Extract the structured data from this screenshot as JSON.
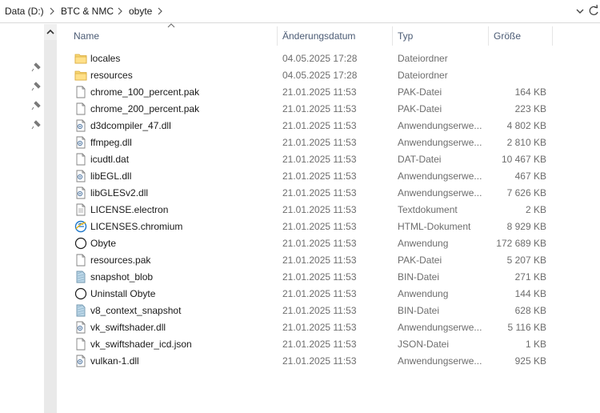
{
  "breadcrumb": {
    "parts": [
      "Data (D:)",
      "BTC & NMC",
      "obyte"
    ]
  },
  "columns": {
    "name": "Name",
    "date": "Änderungsdatum",
    "type": "Typ",
    "size": "Größe"
  },
  "files": [
    {
      "name": "locales",
      "date": "04.05.2025 17:28",
      "type": "Dateiordner",
      "size": "",
      "icon": "folder-icon"
    },
    {
      "name": "resources",
      "date": "04.05.2025 17:28",
      "type": "Dateiordner",
      "size": "",
      "icon": "folder-icon"
    },
    {
      "name": "chrome_100_percent.pak",
      "date": "21.01.2025 11:53",
      "type": "PAK-Datei",
      "size": "164 KB",
      "icon": "file-icon"
    },
    {
      "name": "chrome_200_percent.pak",
      "date": "21.01.2025 11:53",
      "type": "PAK-Datei",
      "size": "223 KB",
      "icon": "file-icon"
    },
    {
      "name": "d3dcompiler_47.dll",
      "date": "21.01.2025 11:53",
      "type": "Anwendungserwe...",
      "size": "4 802 KB",
      "icon": "dll-icon"
    },
    {
      "name": "ffmpeg.dll",
      "date": "21.01.2025 11:53",
      "type": "Anwendungserwe...",
      "size": "2 810 KB",
      "icon": "dll-icon"
    },
    {
      "name": "icudtl.dat",
      "date": "21.01.2025 11:53",
      "type": "DAT-Datei",
      "size": "10 467 KB",
      "icon": "file-icon"
    },
    {
      "name": "libEGL.dll",
      "date": "21.01.2025 11:53",
      "type": "Anwendungserwe...",
      "size": "467 KB",
      "icon": "dll-icon"
    },
    {
      "name": "libGLESv2.dll",
      "date": "21.01.2025 11:53",
      "type": "Anwendungserwe...",
      "size": "7 626 KB",
      "icon": "dll-icon"
    },
    {
      "name": "LICENSE.electron",
      "date": "21.01.2025 11:53",
      "type": "Textdokument",
      "size": "2 KB",
      "icon": "text-file-icon"
    },
    {
      "name": "LICENSES.chromium",
      "date": "21.01.2025 11:53",
      "type": "HTML-Dokument",
      "size": "8 929 KB",
      "icon": "html-file-icon"
    },
    {
      "name": "Obyte",
      "date": "21.01.2025 11:53",
      "type": "Anwendung",
      "size": "172 689 KB",
      "icon": "app-circle-icon"
    },
    {
      "name": "resources.pak",
      "date": "21.01.2025 11:53",
      "type": "PAK-Datei",
      "size": "5 207 KB",
      "icon": "file-icon"
    },
    {
      "name": "snapshot_blob",
      "date": "21.01.2025 11:53",
      "type": "BIN-Datei",
      "size": "271 KB",
      "icon": "bin-file-icon"
    },
    {
      "name": "Uninstall Obyte",
      "date": "21.01.2025 11:53",
      "type": "Anwendung",
      "size": "144 KB",
      "icon": "app-circle-icon"
    },
    {
      "name": "v8_context_snapshot",
      "date": "21.01.2025 11:53",
      "type": "BIN-Datei",
      "size": "628 KB",
      "icon": "bin-file-icon"
    },
    {
      "name": "vk_swiftshader.dll",
      "date": "21.01.2025 11:53",
      "type": "Anwendungserwe...",
      "size": "5 116 KB",
      "icon": "dll-icon"
    },
    {
      "name": "vk_swiftshader_icd.json",
      "date": "21.01.2025 11:53",
      "type": "JSON-Datei",
      "size": "1 KB",
      "icon": "file-icon"
    },
    {
      "name": "vulkan-1.dll",
      "date": "21.01.2025 11:53",
      "type": "Anwendungserwe...",
      "size": "925 KB",
      "icon": "dll-icon"
    }
  ]
}
